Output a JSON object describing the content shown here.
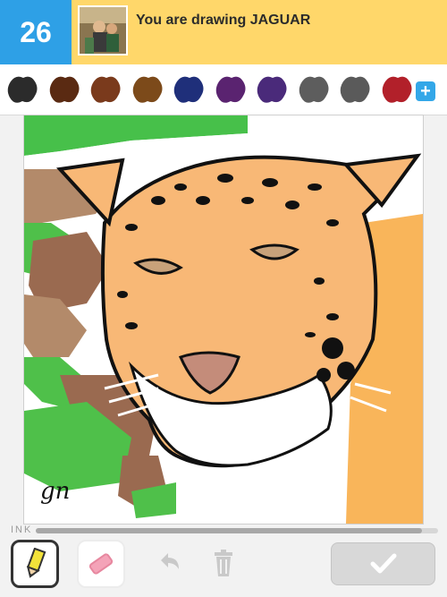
{
  "header": {
    "counter": "26",
    "prompt": "You are drawing JAGUAR"
  },
  "palette": {
    "colors": [
      "#2b2b2b",
      "#5a2a12",
      "#7a3a1c",
      "#7c4a1a",
      "#1f2f7a",
      "#5a2370",
      "#4a2a7a",
      "#5d5d5d",
      "#5a5a5a",
      "#b2202a"
    ],
    "add_label": "+"
  },
  "canvas": {
    "signature": "gn"
  },
  "ink": {
    "label": "INK",
    "remaining": 0.96
  },
  "toolbar": {
    "done_icon": "check-icon"
  }
}
